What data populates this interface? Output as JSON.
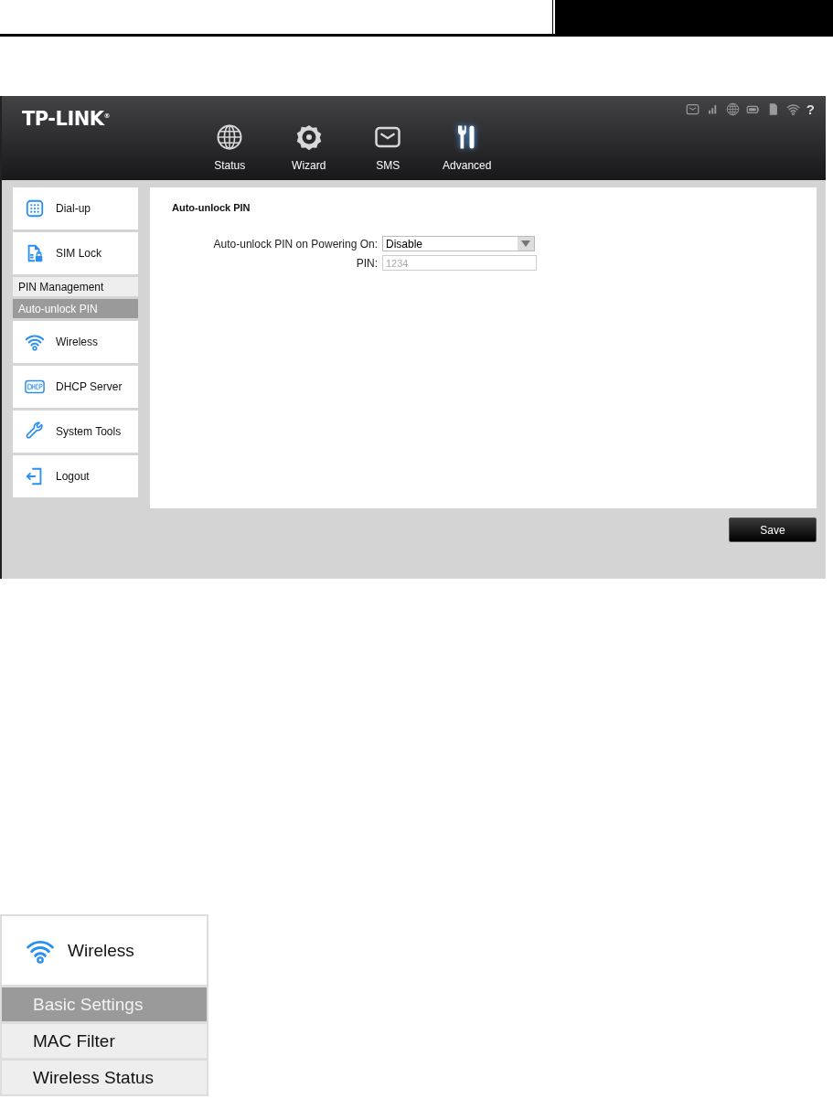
{
  "app": {
    "logo": "TP-LINK",
    "logo_mark": "®",
    "nav": [
      {
        "label": "Status",
        "selected": false
      },
      {
        "label": "Wizard",
        "selected": false
      },
      {
        "label": "SMS",
        "selected": false
      },
      {
        "label": "Advanced",
        "selected": true
      }
    ],
    "help": "?",
    "sidebar": [
      {
        "label": "Dial-up"
      },
      {
        "label": "SIM Lock",
        "children": [
          {
            "label": "PIN Management",
            "selected": false
          },
          {
            "label": "Auto-unlock PIN",
            "selected": true
          }
        ]
      },
      {
        "label": "Wireless"
      },
      {
        "label": "DHCP Server"
      },
      {
        "label": "System Tools"
      },
      {
        "label": "Logout"
      }
    ],
    "content": {
      "title": "Auto-unlock PIN",
      "fields": [
        {
          "label": "Auto-unlock PIN on Powering On:",
          "kind": "select",
          "value": "Disable",
          "disabled": false
        },
        {
          "label": "PIN:",
          "kind": "input",
          "value": "1234",
          "disabled": true
        }
      ]
    },
    "save_button": "Save"
  },
  "wireless_menu": {
    "label": "Wireless",
    "children": [
      {
        "label": "Basic Settings",
        "selected": true
      },
      {
        "label": "MAC Filter",
        "selected": false
      },
      {
        "label": "Wireless Status",
        "selected": false
      }
    ]
  }
}
